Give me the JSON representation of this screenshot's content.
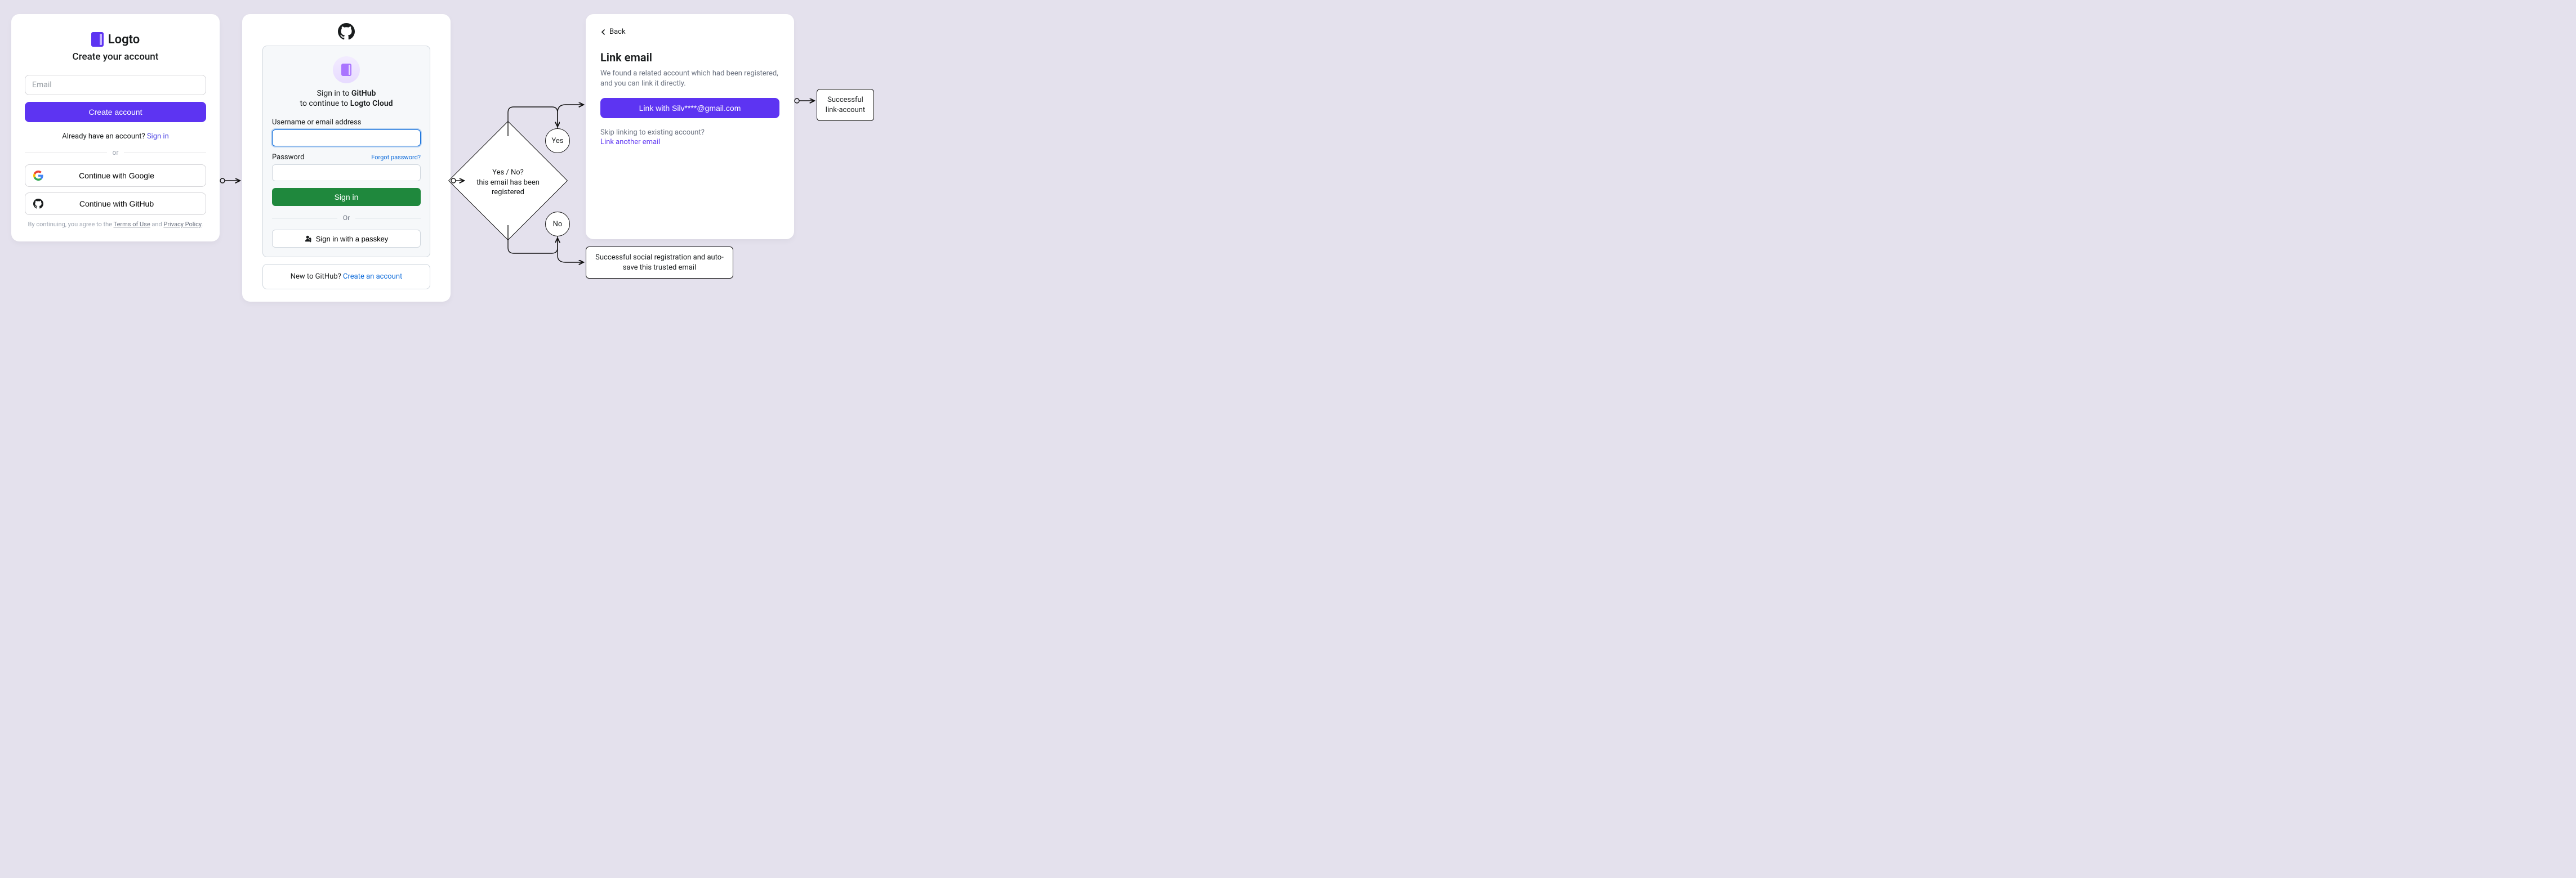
{
  "panel1": {
    "brand": "Logto",
    "subtitle": "Create your account",
    "email_placeholder": "Email",
    "create_btn": "Create account",
    "already_prefix": "Already have an account? ",
    "signin_link": "Sign in",
    "or": "or",
    "google_btn": "Continue with Google",
    "github_btn": "Continue with GitHub",
    "terms_prefix": "By continuing, you agree to the ",
    "terms_link": "Terms of Use",
    "terms_and": " and ",
    "privacy_link": "Privacy Policy",
    "terms_suffix": "."
  },
  "panel2": {
    "sign_in_to_prefix": "Sign in to ",
    "sign_in_to_brand": "GitHub",
    "continue_prefix": "to continue to ",
    "continue_brand": "Logto Cloud",
    "username_label": "Username or email address",
    "password_label": "Password",
    "forgot": "Forgot password?",
    "signin": "Sign in",
    "or": "Or",
    "passkey": "Sign in with a passkey",
    "new_prefix": "New to GitHub? ",
    "create_link": "Create an account"
  },
  "decision": {
    "line1": "Yes / No?",
    "line2": "this email has been registered",
    "yes": "Yes",
    "no": "No"
  },
  "results": {
    "social_reg": "Successful social registration and auto-save this trusted email",
    "link_account": "Successful link-account"
  },
  "panel3": {
    "back": "Back",
    "title": "Link email",
    "desc": "We found a related account which had been registered, and you can link it directly.",
    "link_btn": "Link with Silv****@gmail.com",
    "skip_q": "Skip linking to existing account?",
    "link_another": "Link another email"
  }
}
